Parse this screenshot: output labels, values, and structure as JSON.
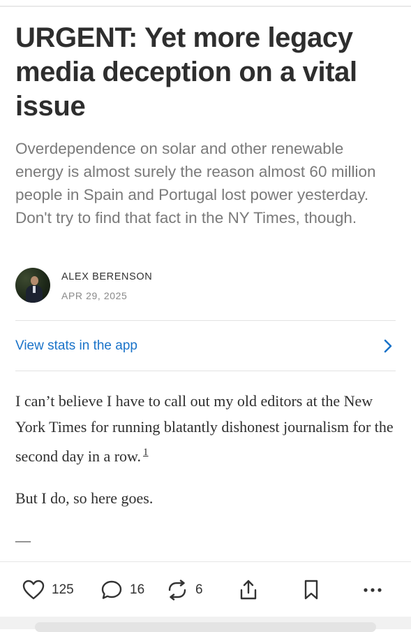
{
  "post": {
    "title": "URGENT: Yet more legacy media deception on a vital issue",
    "subtitle": "Overdependence on solar and other renewable energy is almost surely the reason almost 60 million people in Spain and Portugal lost power yesterday. Don't try to find that fact in the NY Times, though.",
    "author": "ALEX BERENSON",
    "date": "APR 29, 2025"
  },
  "stats_link": {
    "label": "View stats in the app",
    "icon": "chevron-right-icon",
    "accent": "#1a73c9"
  },
  "body": {
    "paragraph1": "I can’t believe I have to call out my old editors at the New York Times for running blatantly dishonest journalism for the second day in a row.",
    "footnote": "1",
    "paragraph2": "But I do, so here goes.",
    "divider": "—"
  },
  "actions": {
    "likes": "125",
    "comments": "16",
    "restacks": "6",
    "icons": [
      "heart-icon",
      "comment-icon",
      "restack-icon",
      "share-icon",
      "bookmark-icon",
      "more-icon"
    ]
  }
}
